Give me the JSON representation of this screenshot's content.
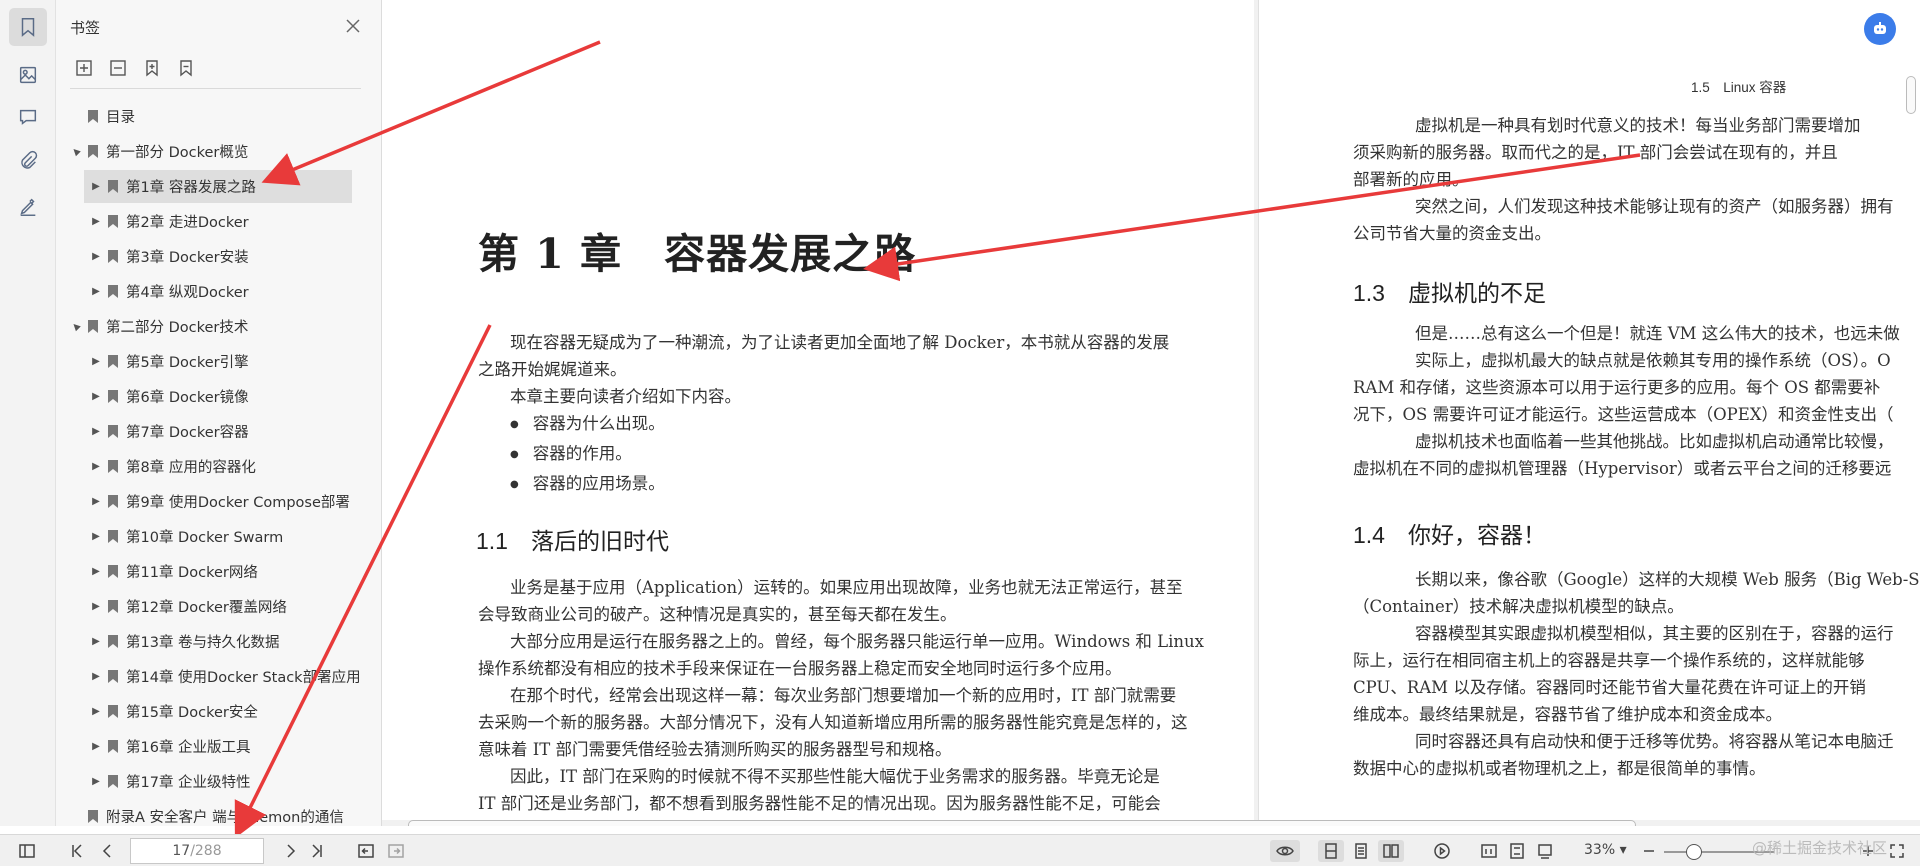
{
  "bookmark_panel": {
    "title": "书签",
    "items": [
      {
        "label": "目录",
        "level": 0,
        "toggle": ""
      },
      {
        "label": "第一部分 Docker概览",
        "level": 0,
        "toggle": "▲"
      },
      {
        "label": "第1章 容器发展之路",
        "level": 1,
        "toggle": "▶",
        "selected": true
      },
      {
        "label": "第2章 走进Docker",
        "level": 1,
        "toggle": "▶"
      },
      {
        "label": "第3章 Docker安装",
        "level": 1,
        "toggle": "▶"
      },
      {
        "label": "第4章 纵观Docker",
        "level": 1,
        "toggle": "▶"
      },
      {
        "label": "第二部分 Docker技术",
        "level": 0,
        "toggle": "▲"
      },
      {
        "label": "第5章 Docker引擎",
        "level": 1,
        "toggle": "▶"
      },
      {
        "label": "第6章 Docker镜像",
        "level": 1,
        "toggle": "▶"
      },
      {
        "label": "第7章 Docker容器",
        "level": 1,
        "toggle": "▶"
      },
      {
        "label": "第8章 应用的容器化",
        "level": 1,
        "toggle": "▶"
      },
      {
        "label": "第9章 使用Docker Compose部署",
        "level": 1,
        "toggle": "▶"
      },
      {
        "label": "第10章 Docker Swarm",
        "level": 1,
        "toggle": "▶"
      },
      {
        "label": "第11章 Docker网络",
        "level": 1,
        "toggle": "▶"
      },
      {
        "label": "第12章 Docker覆盖网络",
        "level": 1,
        "toggle": "▶"
      },
      {
        "label": "第13章 卷与持久化数据",
        "level": 1,
        "toggle": "▶"
      },
      {
        "label": "第14章 使用Docker Stack部署应用",
        "level": 1,
        "toggle": "▶"
      },
      {
        "label": "第15章 Docker安全",
        "level": 1,
        "toggle": "▶"
      },
      {
        "label": "第16章 企业版工具",
        "level": 1,
        "toggle": "▶"
      },
      {
        "label": "第17章 企业级特性",
        "level": 1,
        "toggle": "▶"
      },
      {
        "label": "附录A 安全客户 端与daemon的通信",
        "level": 0,
        "toggle": ""
      }
    ]
  },
  "left_page": {
    "chapter_title": "第 1 章　容器发展之路",
    "intro_1": "现在容器无疑成为了一种潮流，为了让读者更加全面地了解 Docker，本书就从容器的发展",
    "intro_2": "之路开始娓娓道来。",
    "intro_3": "本章主要向读者介绍如下内容。",
    "bullets": [
      "容器为什么出现。",
      "容器的作用。",
      "容器的应用场景。"
    ],
    "section_1_1": "1.1　落后的旧时代",
    "p1_1": "业务是基于应用（Application）运转的。如果应用出现故障，业务也就无法正常运行，甚至",
    "p1_2": "会导致商业公司的破产。这种情况是真实的，甚至每天都在发生。",
    "p2_1": "大部分应用是运行在服务器之上的。曾经，每个服务器只能运行单一应用。Windows 和 Linux",
    "p2_2": "操作系统都没有相应的技术手段来保证在一台服务器上稳定而安全地同时运行多个应用。",
    "p3_1": "在那个时代，经常会出现这样一幕：每次业务部门想要增加一个新的应用时，IT 部门就需要",
    "p3_2": "去采购一个新的服务器。大部分情况下，没有人知道新增应用所需的服务器性能究竟是怎样的，这",
    "p3_3": "意味着 IT 部门需要凭借经验去猜测所购买的服务器型号和规格。",
    "p4_1": "因此，IT 部门在采购的时候就不得不买那些性能大幅优于业务需求的服务器。毕竟无论是",
    "p4_2": "IT 部门还是业务部门，都不想看到服务器性能不足的情况出现。因为服务器性能不足，可能会"
  },
  "right_page": {
    "running_head": "1.5　Linux 容器",
    "r1_1": "虚拟机是一种具有划时代意义的技术！每当业务部门需要增加",
    "r1_2": "须采购新的服务器。取而代之的是，IT 部门会尝试在现有的，并且",
    "r1_3": "部署新的应用。",
    "r2_1": "突然之间，人们发现这种技术能够让现有的资产（如服务器）拥有",
    "r2_2": "公司节省大量的资金支出。",
    "section_1_3": "1.3　虚拟机的不足",
    "r3_1": "但是……总有这么一个但是！就连 VM 这么伟大的技术，也远未做",
    "r3_2": "实际上，虚拟机最大的缺点就是依赖其专用的操作系统（OS）。O",
    "r3_3": "RAM 和存储，这些资源本可以用于运行更多的应用。每个 OS 都需要补",
    "r3_4": "况下，OS 需要许可证才能运行。这些运营成本（OPEX）和资金性支出（",
    "r3_5": "虚拟机技术也面临着一些其他挑战。比如虚拟机启动通常比较慢，",
    "r3_6": "虚拟机在不同的虚拟机管理器（Hypervisor）或者云平台之间的迁移要远",
    "section_1_4": "1.4　你好，容器！",
    "r4_1": "长期以来，像谷歌（Google）这样的大规模 Web 服务（Big Web-S",
    "r4_2": "（Container）技术解决虚拟机模型的缺点。",
    "r4_3": "容器模型其实跟虚拟机模型相似，其主要的区别在于，容器的运行",
    "r4_4": "际上，运行在相同宿主机上的容器是共享一个操作系统的，这样就能够",
    "r4_5": "CPU、RAM 以及存储。容器同时还能节省大量花费在许可证上的开销",
    "r4_6": "维成本。最终结果就是，容器节省了维护成本和资金成本。",
    "r4_7": "同时容器还具有启动快和便于迁移等优势。将容器从笔记本电脑迁",
    "r4_8": "数据中心的虚拟机或者物理机之上，都是很简单的事情。"
  },
  "bottom_bar": {
    "current_page": "17",
    "total_pages": "/288",
    "zoom": "33%",
    "zoom_arrow": "▾",
    "watermark": "@稀土掘金技术社区"
  },
  "colors": {
    "accent": "#3b7ce9",
    "annotation_arrow": "#e83a3a"
  }
}
